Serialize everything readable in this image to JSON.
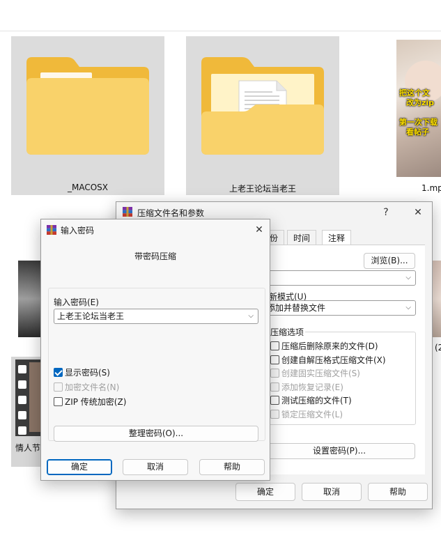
{
  "explorer": {
    "items": [
      {
        "name": "_MACOSX"
      },
      {
        "name": "上老王论坛当老王"
      },
      {
        "name": "1.mp"
      },
      {
        "name": "情人节"
      },
      {
        "name": "(2"
      }
    ],
    "thumb_caption_lines": [
      "把这个文",
      "改为zip",
      "第一次下载",
      "看帖子"
    ]
  },
  "archive_dialog": {
    "title": "压缩文件名和参数",
    "help_glyph": "?",
    "close_glyph": "✕",
    "tabs": [
      "份",
      "时间",
      "注释"
    ],
    "browse_button": "浏览(B)...",
    "update_mode_label": "新模式(U)",
    "update_mode_value": "添加并替换文件",
    "options_group_label": "压缩选项",
    "options": [
      {
        "label": "压缩后删除原来的文件(D)",
        "checked": false,
        "disabled": false
      },
      {
        "label": "创建自解压格式压缩文件(X)",
        "checked": false,
        "disabled": false
      },
      {
        "label": "创建固实压缩文件(S)",
        "checked": false,
        "disabled": true
      },
      {
        "label": "添加恢复记录(E)",
        "checked": false,
        "disabled": true
      },
      {
        "label": "测试压缩的文件(T)",
        "checked": false,
        "disabled": false
      },
      {
        "label": "锁定压缩文件(L)",
        "checked": false,
        "disabled": true
      }
    ],
    "set_password_button": "设置密码(P)...",
    "ok_button": "确定",
    "cancel_button": "取消",
    "help_button": "帮助"
  },
  "password_dialog": {
    "title": "输入密码",
    "close_glyph": "✕",
    "heading": "带密码压缩",
    "password_label": "输入密码(E)",
    "password_value": "上老王论坛当老王",
    "checkboxes": [
      {
        "label": "显示密码(S)",
        "checked": true,
        "disabled": false
      },
      {
        "label": "加密文件名(N)",
        "checked": false,
        "disabled": true
      },
      {
        "label": "ZIP 传统加密(Z)",
        "checked": false,
        "disabled": false
      }
    ],
    "organize_button": "整理密码(O)...",
    "ok_button": "确定",
    "cancel_button": "取消",
    "help_button": "帮助"
  },
  "colors": {
    "folder_yellow": "#f6c94f",
    "folder_light": "#fbdc7a",
    "accent_blue": "#0067c0"
  }
}
